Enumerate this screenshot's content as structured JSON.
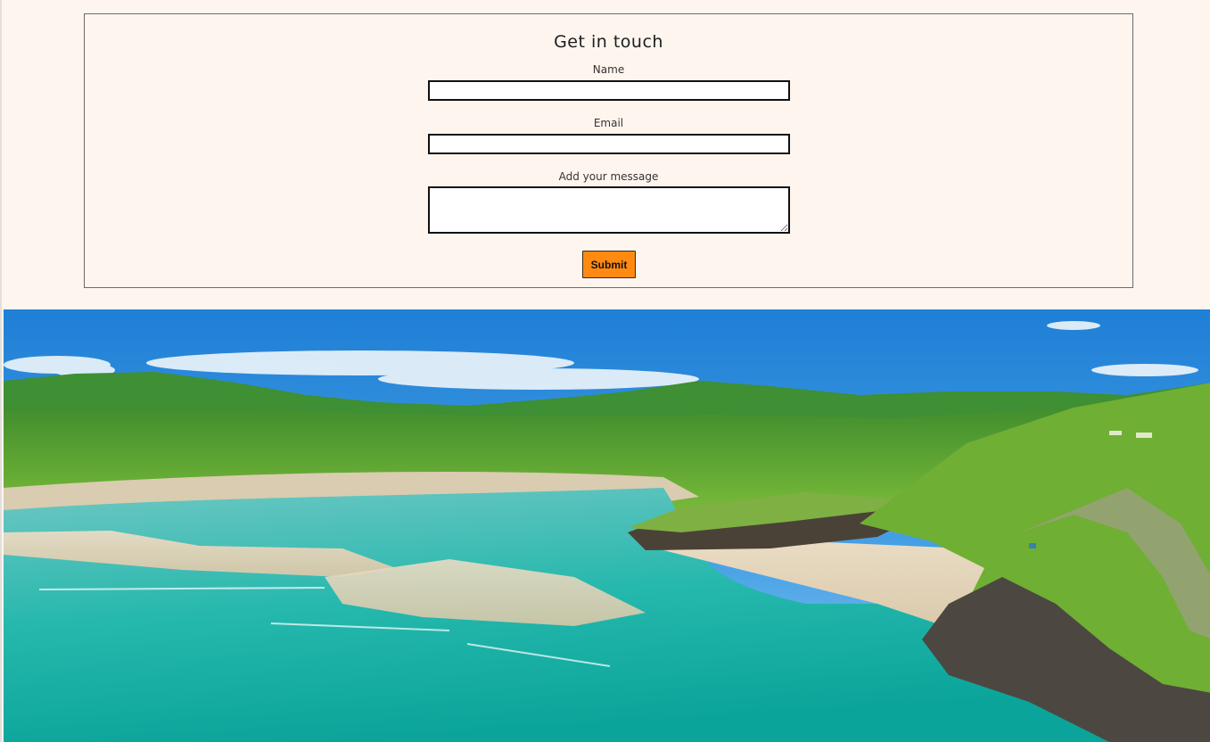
{
  "contact_form": {
    "title": "Get in touch",
    "name_label": "Name",
    "name_value": "",
    "email_label": "Email",
    "email_value": "",
    "message_label": "Add your message",
    "message_value": "",
    "submit_label": "Submit"
  },
  "colors": {
    "page_background": "#fff5ef",
    "submit_button": "#ff8a12",
    "box_border": "#6b6b6b"
  }
}
